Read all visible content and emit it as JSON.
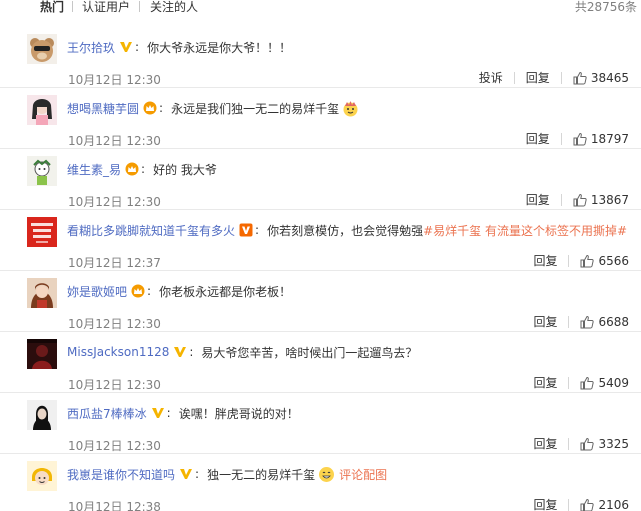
{
  "tabs": [
    {
      "label": "热门"
    },
    {
      "label": "认证用户"
    },
    {
      "label": "关注的人"
    }
  ],
  "total_count": "共28756条",
  "colors": {
    "accent": "#eb7350",
    "link_blue": "#4f6bc2",
    "muted": "#808080"
  },
  "comments": [
    {
      "user": "王尔拾玖",
      "badge": "yellow-v-icon",
      "text": "你大爷永远是你大爷！！！",
      "time": "10月12日 12:30",
      "report": "投诉",
      "reply": "回复",
      "likes": "38465"
    },
    {
      "user": "想喝黑糖芋圆",
      "badge": "crown-icon",
      "text": "永远是我们独一无二的易烊千玺",
      "emoji": "crown-face-emoji",
      "time": "10月12日 12:30",
      "reply": "回复",
      "likes": "18797"
    },
    {
      "user": "维生素_易",
      "badge": "crown-icon",
      "text": "好的 我大爷",
      "time": "10月12日 12:30",
      "reply": "回复",
      "likes": "13867"
    },
    {
      "user": "看糊比多跳脚就知道千玺有多火",
      "badge": "orange-v-icon",
      "text": "你若刻意模仿，也会觉得勉强",
      "topic1": "#易烊千玺 有流量这个标签不用撕掉#",
      "time": "10月12日 12:37",
      "reply": "回复",
      "likes": "6566"
    },
    {
      "user": "妳是歌姬吧",
      "badge": "crown-icon",
      "text": "你老板永远都是你老板！",
      "time": "10月12日 12:30",
      "reply": "回复",
      "likes": "6688"
    },
    {
      "user": "MissJackson1128",
      "badge": "yellow-v-icon",
      "text": "易大爷您辛苦，啥时候出门一起遛鸟去？",
      "time": "10月12日 12:30",
      "reply": "回复",
      "likes": "5409"
    },
    {
      "user": "西瓜盐7棒棒冰",
      "badge": "yellow-v-icon",
      "text": "诶嘿！胖虎哥说的对！",
      "time": "10月12日 12:30",
      "reply": "回复",
      "likes": "3325"
    },
    {
      "user": "我崽是谁你不知道吗",
      "badge": "yellow-v-icon",
      "text": "独一无二的易烊千玺",
      "emoji": "grin-emoji",
      "picture_link": "评论配图",
      "time": "10月12日 12:38",
      "reply": "回复",
      "likes": "2106"
    }
  ]
}
